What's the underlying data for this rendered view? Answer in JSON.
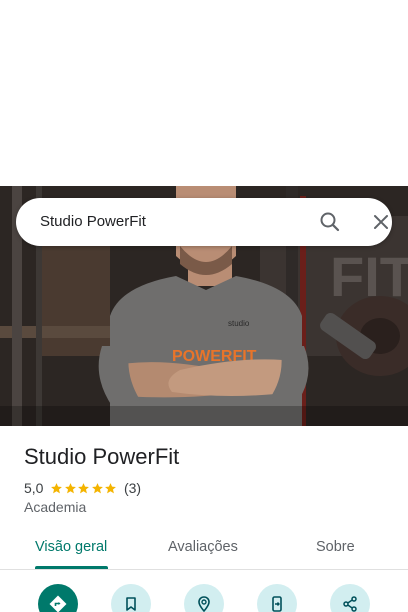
{
  "search": {
    "query": "Studio PowerFit"
  },
  "place": {
    "name": "Studio PowerFit",
    "rating": "5,0",
    "stars": 5,
    "review_count": "(3)",
    "category": "Academia"
  },
  "photo": {
    "shirt_logo_small": "studio",
    "shirt_logo_main": "POWERFIT",
    "wall_letters": "FIT"
  },
  "tabs": [
    {
      "label": "Visão geral",
      "active": true
    },
    {
      "label": "Avaliações",
      "active": false
    },
    {
      "label": "Sobre",
      "active": false
    }
  ],
  "actions": [
    {
      "icon": "directions-icon"
    },
    {
      "icon": "save-bookmark-icon"
    },
    {
      "icon": "nearby-icon"
    },
    {
      "icon": "send-to-phone-icon"
    },
    {
      "icon": "share-icon"
    }
  ],
  "colors": {
    "accent": "#00796b",
    "action_bg": "#d2eef0",
    "star": "#f4b400",
    "shirt_logo": "#e8742a"
  }
}
